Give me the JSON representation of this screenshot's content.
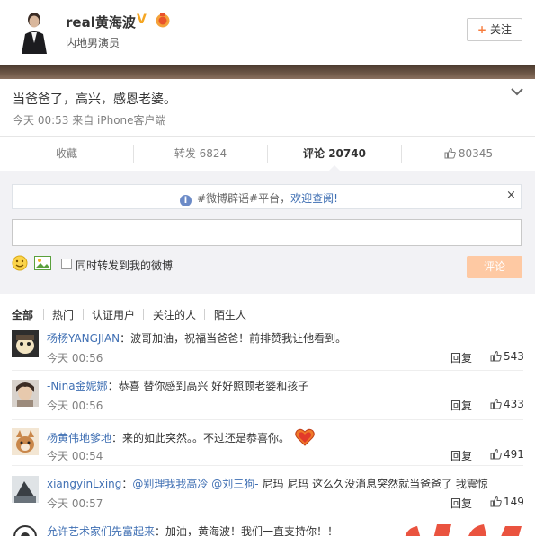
{
  "header": {
    "username": "real黄海波",
    "verified_badge": "V",
    "title": "内地男演员",
    "follow_label": "关注",
    "follow_plus": "+"
  },
  "post": {
    "text": "当爸爸了，高兴，感恩老婆。",
    "meta": "今天 00:53 来自 iPhone客户端"
  },
  "actions": {
    "favorite": "收藏",
    "repost": "转发 6824",
    "comment": "评论 20740",
    "like": "80345"
  },
  "comment_box": {
    "notice_text": "#微博辟谣#平台，",
    "notice_link": "欢迎查阅!",
    "notice_close": "×",
    "input_value": "",
    "also_repost_label": "同时转发到我的微博",
    "submit_label": "评论"
  },
  "filters": [
    "全部",
    "热门",
    "认证用户",
    "关注的人",
    "陌生人"
  ],
  "comments": [
    {
      "user": "杨杨YANGJIAN",
      "text": "：波哥加油，祝福当爸爸！前排赞我让他看到。",
      "time": "今天 00:56",
      "reply": "回复",
      "likes": "543"
    },
    {
      "user": "-Nina金妮娜",
      "text": "：恭喜 替你感到高兴 好好照顾老婆和孩子",
      "time": "今天 00:56",
      "reply": "回复",
      "likes": "433"
    },
    {
      "user": "杨黄伟地爹地",
      "text": "：来的如此突然。。不过还是恭喜你。",
      "time": "今天 00:54",
      "reply": "回复",
      "likes": "491"
    },
    {
      "user": "xiangyinLxing",
      "text_prefix": "：",
      "mention1": "@别理我我高冷",
      "mention2": "@刘三狗-",
      "text_rest": "尼玛 尼玛 这么久没消息突然就当爸爸了 我震惊",
      "time": "今天 00:57",
      "reply": "回复",
      "likes": "149"
    },
    {
      "user": "允许艺术家们先富起来",
      "text": "：加油，黄海波！我们一直支持你！！"
    }
  ],
  "colors": {
    "link": "#3f6fb3",
    "accent_orange": "#f77c3d",
    "submit_disabled": "#fec9a3",
    "panel_bg": "#f2f2f5"
  }
}
